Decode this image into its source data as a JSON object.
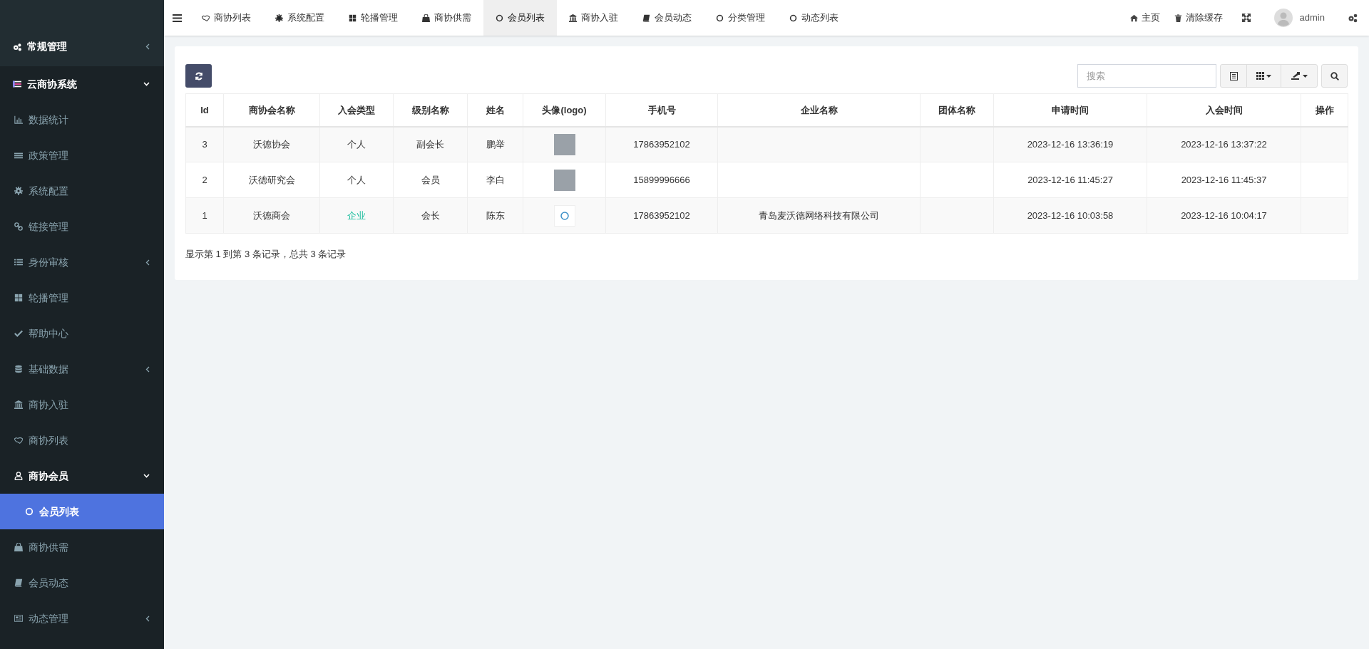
{
  "sidebar": {
    "items": [
      {
        "label": "常规管理",
        "expanded": false,
        "selected": false
      },
      {
        "label": "云商协系统",
        "expanded": true,
        "selected": false,
        "children": [
          {
            "label": "数据统计",
            "selected": false
          },
          {
            "label": "政策管理",
            "selected": false
          },
          {
            "label": "系统配置",
            "selected": false
          },
          {
            "label": "链接管理",
            "selected": false
          },
          {
            "label": "身份审核",
            "expanded": false,
            "selected": false
          },
          {
            "label": "轮播管理",
            "selected": false
          },
          {
            "label": "帮助中心",
            "selected": false
          },
          {
            "label": "基础数据",
            "expanded": false,
            "selected": false
          },
          {
            "label": "商协入驻",
            "selected": false
          },
          {
            "label": "商协列表",
            "selected": false
          },
          {
            "label": "商协会员",
            "expanded": true,
            "selected": false,
            "children": [
              {
                "label": "会员列表",
                "selected": true
              }
            ]
          },
          {
            "label": "商协供需",
            "selected": false
          },
          {
            "label": "会员动态",
            "selected": false
          },
          {
            "label": "动态管理",
            "expanded": false,
            "selected": false
          }
        ]
      }
    ]
  },
  "topbar": {
    "tabs": [
      {
        "label": "商协列表",
        "selected": false
      },
      {
        "label": "系统配置",
        "selected": false
      },
      {
        "label": "轮播管理",
        "selected": false
      },
      {
        "label": "商协供需",
        "selected": false
      },
      {
        "label": "会员列表",
        "selected": true
      },
      {
        "label": "商协入驻",
        "selected": false
      },
      {
        "label": "会员动态",
        "selected": false
      },
      {
        "label": "分类管理",
        "selected": false
      },
      {
        "label": "动态列表",
        "selected": false
      }
    ],
    "actions": [
      "主页",
      "清除缓存"
    ],
    "user": "admin"
  },
  "toolbar": {
    "search": {
      "placeholder": "搜索"
    }
  },
  "table": {
    "columns": [
      "Id",
      "商协会名称",
      "入会类型",
      "级别名称",
      "姓名",
      "头像(logo)",
      "手机号",
      "企业名称",
      "团体名称",
      "申请时间",
      "入会时间",
      "操作"
    ],
    "rows": [
      {
        "id": "3",
        "association": "沃德协会",
        "type": "个人",
        "color": "#333333",
        "level_name": "副会长",
        "name": "鹏举",
        "kind": "photo",
        "phone": "17863952102",
        "company": "",
        "group": "",
        "applied": "2023-12-16 13:36:19",
        "joined": "2023-12-16 13:37:22"
      },
      {
        "id": "2",
        "association": "沃德研究会",
        "type": "个人",
        "color": "#333333",
        "level_name": "会员",
        "name": "李白",
        "kind": "photo",
        "phone": "15899996666",
        "company": "",
        "group": "",
        "applied": "2023-12-16 11:45:27",
        "joined": "2023-12-16 11:45:37"
      },
      {
        "id": "1",
        "association": "沃德商会",
        "type": "企业",
        "color": "#18bc9c",
        "level_name": "会长",
        "name": "陈东",
        "kind": "logo",
        "phone": "17863952102",
        "company": "青岛麦沃德网络科技有限公司",
        "group": "",
        "applied": "2023-12-16 10:03:58",
        "joined": "2023-12-16 10:04:17"
      }
    ]
  },
  "pagination": {
    "summary": "显示第 1 到第 3 条记录，总共 3 条记录"
  }
}
